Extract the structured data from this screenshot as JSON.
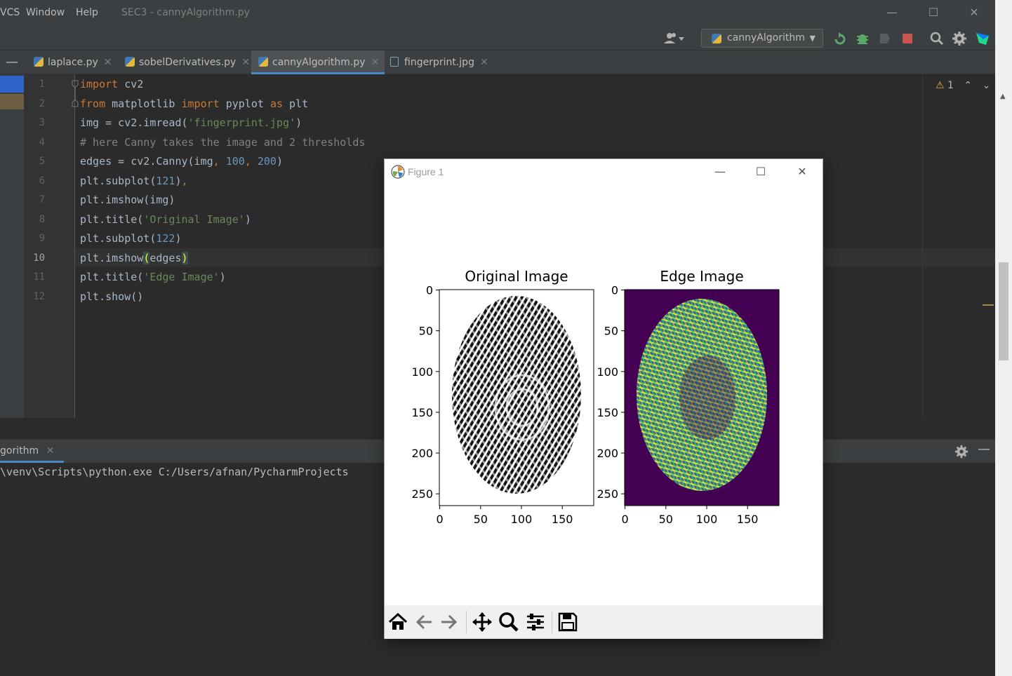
{
  "menu": {
    "items": [
      "VCS",
      "Window",
      "Help"
    ]
  },
  "window": {
    "title": "SEC3 - cannyAlgorithm.py"
  },
  "toolbar": {
    "run_config": "cannyAlgorithm"
  },
  "tabs": [
    {
      "label": "laplace.py",
      "type": "python"
    },
    {
      "label": "sobelDerivatives.py",
      "type": "python"
    },
    {
      "label": "cannyAlgorithm.py",
      "type": "python",
      "active": true
    },
    {
      "label": "fingerprint.jpg",
      "type": "image"
    }
  ],
  "inspection": {
    "warnings": "1"
  },
  "editor": {
    "line_numbers": [
      "1",
      "2",
      "3",
      "4",
      "5",
      "6",
      "7",
      "8",
      "9",
      "10",
      "11",
      "12"
    ],
    "current_line": "10"
  },
  "run_panel": {
    "tab_label": "gorithm",
    "command": "\\venv\\Scripts\\python.exe C:/Users/afnan/PycharmProjects"
  },
  "figure": {
    "title": "Figure 1",
    "left_plot": {
      "title": "Original Image",
      "y_ticks": [
        "0",
        "50",
        "100",
        "150",
        "200",
        "250"
      ],
      "x_ticks": [
        "0",
        "50",
        "100",
        "150"
      ]
    },
    "right_plot": {
      "title": "Edge Image",
      "y_ticks": [
        "0",
        "50",
        "100",
        "150",
        "200",
        "250"
      ],
      "x_ticks": [
        "0",
        "50",
        "100",
        "150"
      ]
    }
  },
  "colors": {
    "keyword": "#cc7832",
    "string": "#6a8759",
    "number": "#6897bb",
    "comment": "#808080",
    "edge_bg": "#440154"
  }
}
